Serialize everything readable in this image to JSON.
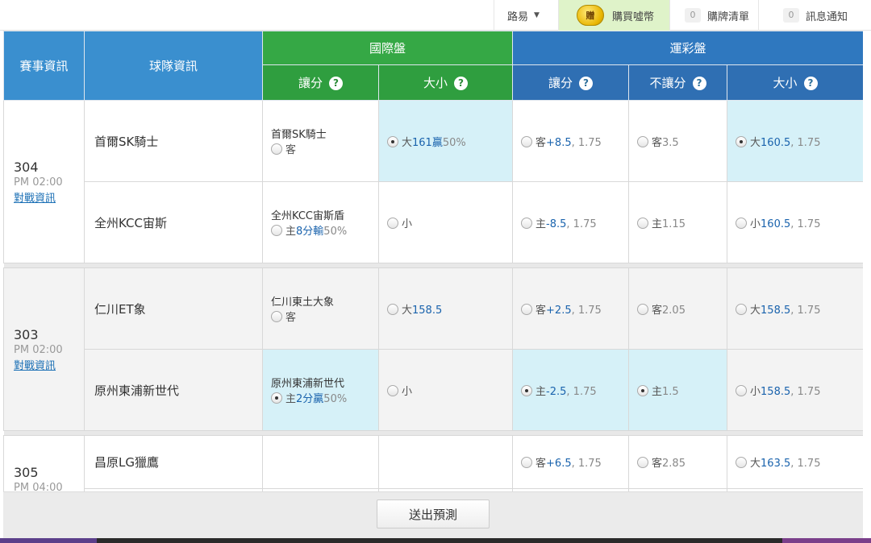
{
  "topbar": {
    "market_label": "路易",
    "buy_coin_icon_text": "贈",
    "buy_label": "購買噓幣",
    "cart_count": "0",
    "cart_label": "購牌清單",
    "msg_count": "0",
    "msg_label": "訊息通知"
  },
  "headers": {
    "game_info": "賽事資訊",
    "team_info": "球隊資訊",
    "intl": "國際盤",
    "lottery": "運彩盤",
    "intl_spread": "讓分",
    "intl_total": "大小",
    "lot_spread": "讓分",
    "lot_moneyline": "不讓分",
    "lot_total": "大小",
    "help": "?"
  },
  "games": [
    {
      "no": "304",
      "time": "PM 02:00",
      "link": "對戰資訊",
      "rows": [
        {
          "team": "首爾SK騎士",
          "intl_spread_team": "首爾SK騎士",
          "intl_spread_side": "客",
          "intl_spread_extra": "",
          "intl_total_side": "大",
          "intl_total_val": "161贏",
          "intl_total_pct": "50%",
          "lot_spread_side": "客",
          "lot_spread_val": "+8.5",
          "lot_spread_odds": ", 1.75",
          "lot_ml_side": "客",
          "lot_ml_odds": "3.5",
          "lot_total_side": "大",
          "lot_total_val": "160.5",
          "lot_total_odds": ", 1.75"
        },
        {
          "team": "全州KCC宙斯",
          "intl_spread_team": "全州KCC宙斯盾",
          "intl_spread_side": "主",
          "intl_spread_extra": "8分輸",
          "intl_spread_pct": "50%",
          "intl_total_side": "小",
          "lot_spread_side": "主",
          "lot_spread_val": "-8.5",
          "lot_spread_odds": ", 1.75",
          "lot_ml_side": "主",
          "lot_ml_odds": "1.15",
          "lot_total_side": "小",
          "lot_total_val": "160.5",
          "lot_total_odds": ", 1.75"
        }
      ]
    },
    {
      "no": "303",
      "time": "PM 02:00",
      "link": "對戰資訊",
      "rows": [
        {
          "team": "仁川ET象",
          "intl_spread_team": "仁川東土大象",
          "intl_spread_side": "客",
          "intl_total_side": "大",
          "intl_total_val": "158.5",
          "lot_spread_side": "客",
          "lot_spread_val": "+2.5",
          "lot_spread_odds": ", 1.75",
          "lot_ml_side": "客",
          "lot_ml_odds": "2.05",
          "lot_total_side": "大",
          "lot_total_val": "158.5",
          "lot_total_odds": ", 1.75"
        },
        {
          "team": "原州東浦新世代",
          "intl_spread_team": "原州東浦新世代",
          "intl_spread_side": "主",
          "intl_spread_extra": "2分贏",
          "intl_spread_pct": "50%",
          "intl_total_side": "小",
          "lot_spread_side": "主",
          "lot_spread_val": "-2.5",
          "lot_spread_odds": ", 1.75",
          "lot_ml_side": "主",
          "lot_ml_odds": "1.5",
          "lot_total_side": "小",
          "lot_total_val": "158.5",
          "lot_total_odds": ", 1.75"
        }
      ]
    },
    {
      "no": "305",
      "time": "PM 04:00",
      "rows": [
        {
          "team": "昌原LG獵鷹",
          "lot_spread_side": "客",
          "lot_spread_val": "+6.5",
          "lot_spread_odds": ", 1.75",
          "lot_ml_side": "客",
          "lot_ml_odds": "2.85",
          "lot_total_side": "大",
          "lot_total_val": "163.5",
          "lot_total_odds": ", 1.75"
        }
      ]
    }
  ],
  "submit_label": "送出預測"
}
